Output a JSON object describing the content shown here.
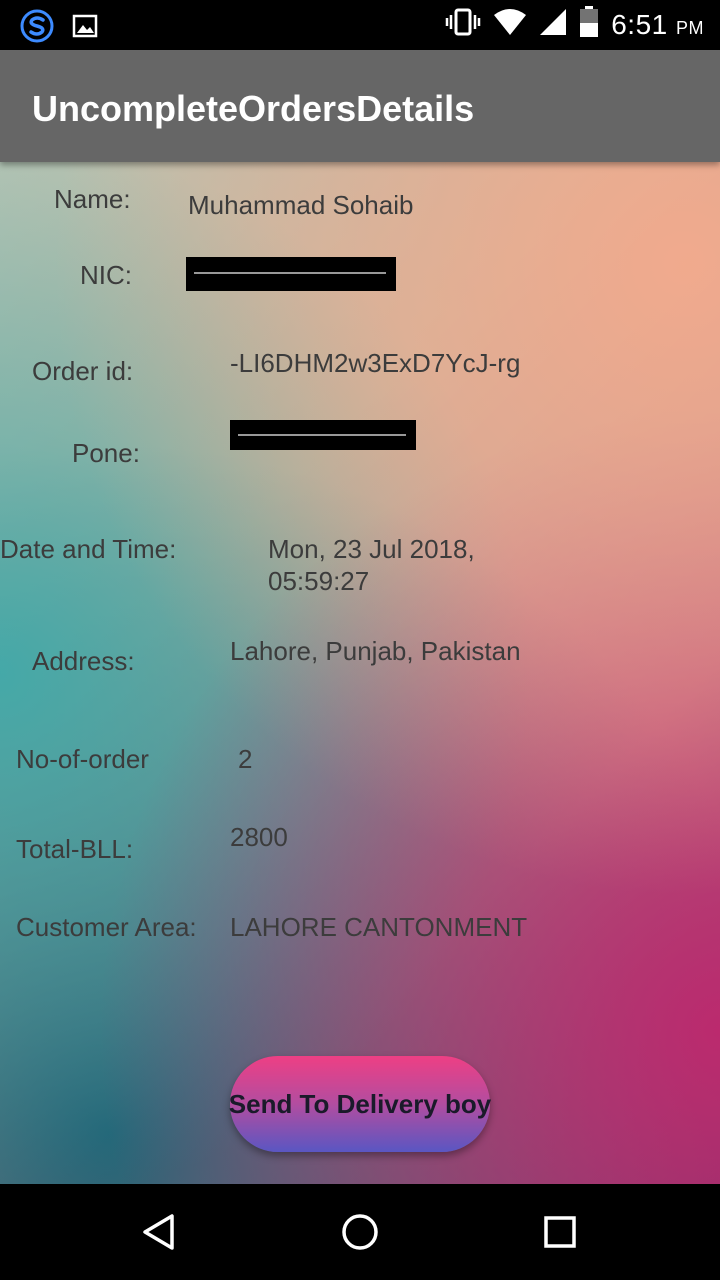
{
  "status_bar": {
    "time": "6:51",
    "ampm": "PM",
    "left_icons": [
      "s-app-icon",
      "image-icon"
    ],
    "right_icons": [
      "vibrate-icon",
      "wifi-icon",
      "signal-icon",
      "battery-icon"
    ]
  },
  "app_bar": {
    "title": "UncompleteOrdersDetails"
  },
  "details": {
    "name_label": "Name:",
    "name_value": "Muhammad Sohaib",
    "nic_label": "NIC:",
    "order_id_label": "Order id:",
    "order_id_value": "-LI6DHM2w3ExD7YcJ-rg",
    "phone_label": "Pone:",
    "datetime_label": "Date and Time:",
    "datetime_line1": "Mon, 23 Jul 2018,",
    "datetime_line2": "05:59:27",
    "address_label": "Address:",
    "address_value": "Lahore, Punjab, Pakistan",
    "orders_label": "No-of-order",
    "orders_value": "2",
    "bill_label": "Total-BLL:",
    "bill_value": "2800",
    "area_label": "Customer Area:",
    "area_value": "LAHORE CANTONMENT"
  },
  "action": {
    "send_label": "Send To Delivery boy"
  },
  "nav_bar": {
    "icons": [
      "back-icon",
      "home-icon",
      "recents-icon"
    ]
  }
}
